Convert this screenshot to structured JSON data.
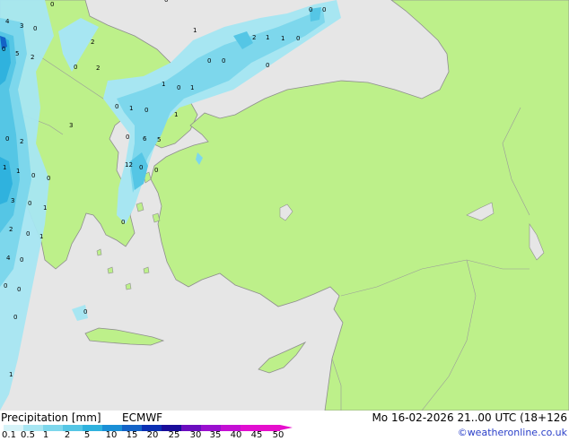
{
  "header": {
    "title": "Precipitation [mm]",
    "model": "ECMWF",
    "datetime": "Mo 16-02-2026 21..00 UTC (18+126",
    "credit": "©weatheronline.co.uk"
  },
  "legend": {
    "labels": [
      "0.1",
      "0.5",
      "1",
      "2",
      "5",
      "10",
      "15",
      "20",
      "25",
      "30",
      "35",
      "40",
      "45",
      "50"
    ],
    "colors": [
      "#d6f3f8",
      "#a7e6f2",
      "#7dd7ec",
      "#55c6e5",
      "#2fb2de",
      "#1a8fd6",
      "#1363c7",
      "#0b2fb3",
      "#1a0d9a",
      "#6b0dbf",
      "#9a0fcf",
      "#c40fd4",
      "#e10ed1",
      "#e60ecc"
    ]
  },
  "map": {
    "colors": {
      "sea": "#e6e6e6",
      "land": "#bdf08a",
      "coast": "#8e8e8e",
      "border": "#9a9a9a"
    },
    "point_labels": [
      "0",
      "0",
      "4",
      "3",
      "0",
      "2",
      "0",
      "5",
      "2",
      "0",
      "2",
      "1",
      "2",
      "1",
      "1",
      "0",
      "0",
      "0",
      "1",
      "0",
      "1",
      "0",
      "1",
      "0",
      "1",
      "0",
      "2",
      "3",
      "0",
      "6",
      "5",
      "1",
      "1",
      "0",
      "0",
      "3",
      "0",
      "1",
      "12",
      "0",
      "0",
      "2",
      "0",
      "1",
      "0",
      "4",
      "0",
      "0",
      "0",
      "0",
      "1",
      "0",
      "0",
      "0",
      "0"
    ]
  }
}
